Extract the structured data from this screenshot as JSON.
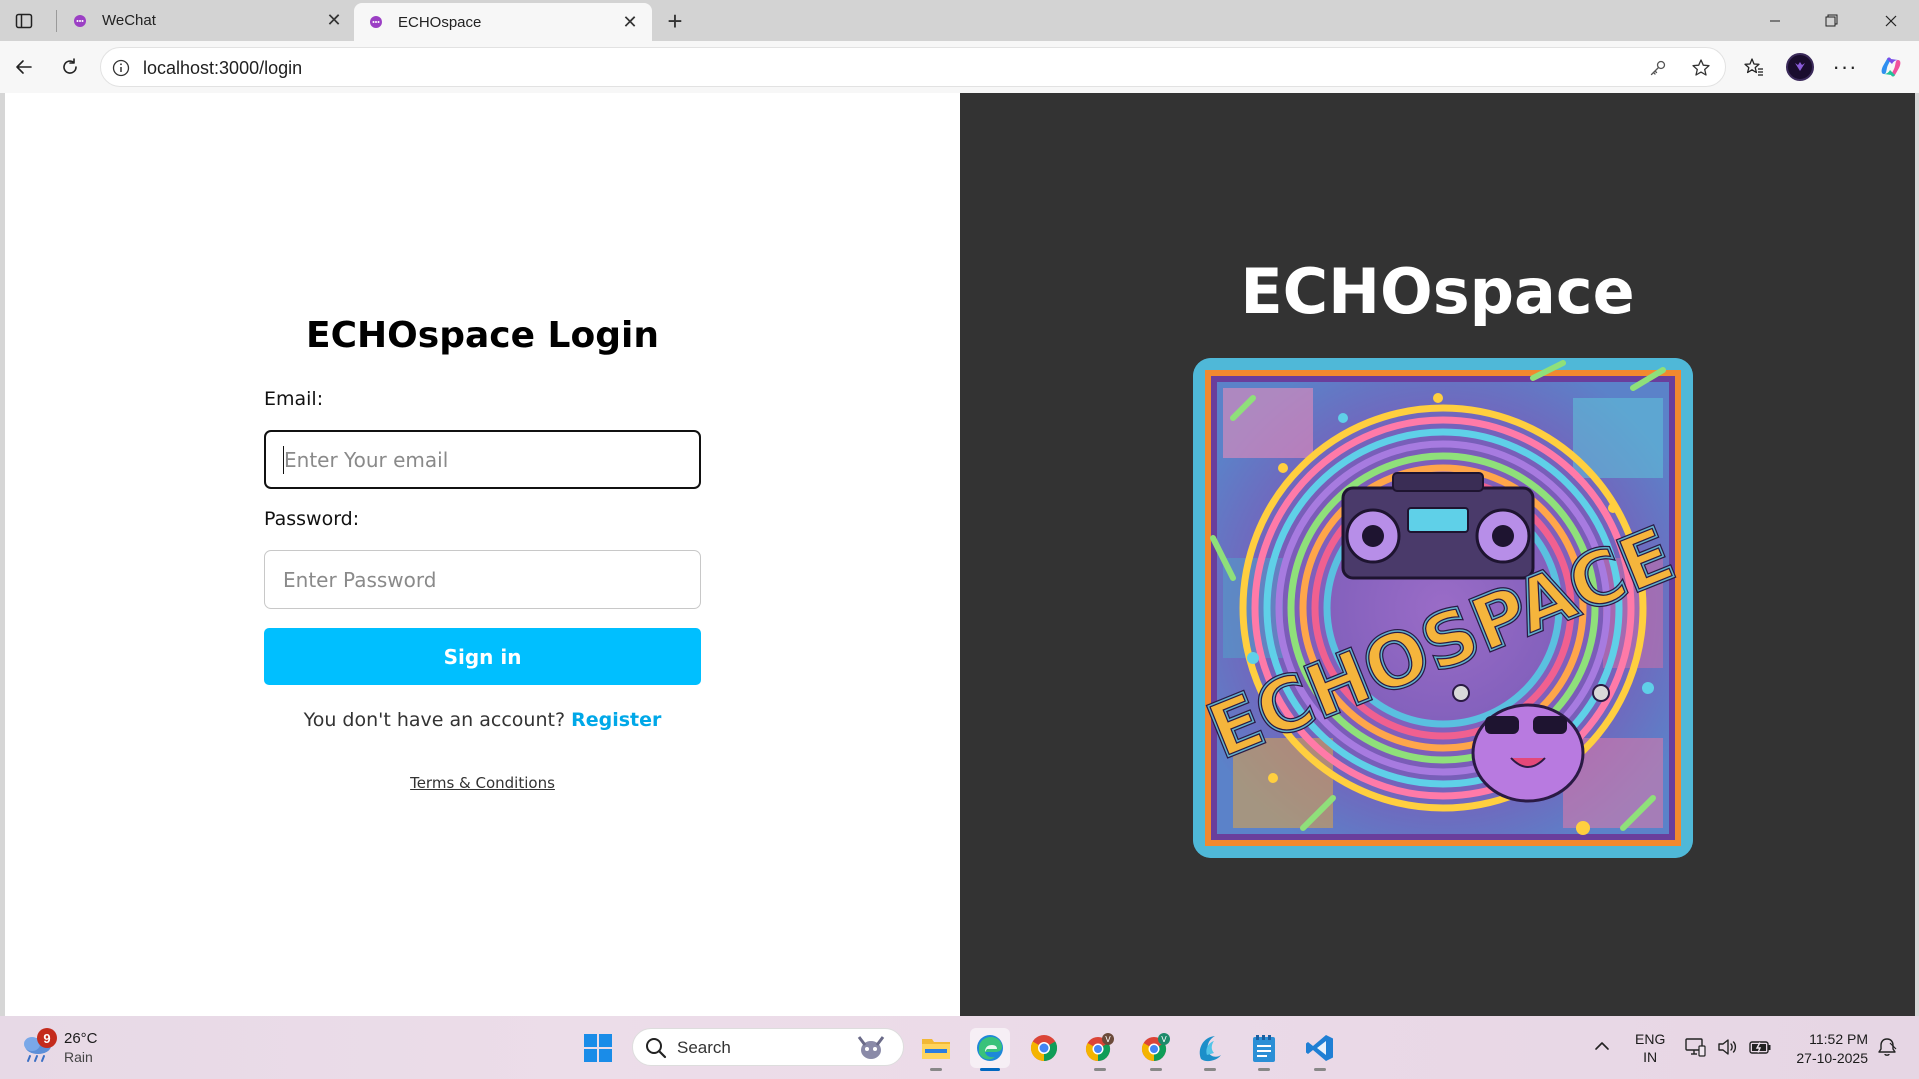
{
  "browser": {
    "tabs": [
      {
        "title": "WeChat",
        "active": false
      },
      {
        "title": "ECHOspace",
        "active": true
      }
    ],
    "url": "localhost:3000/login",
    "accent": "#0067c0"
  },
  "login": {
    "title": "ECHOspace Login",
    "email_label": "Email:",
    "email_placeholder": "Enter Your email",
    "password_label": "Password:",
    "password_placeholder": "Enter Password",
    "signin_label": "Sign in",
    "register_prompt": "You don't have an account?",
    "register_link": "Register",
    "terms_link": "Terms & Conditions",
    "button_color": "#00bfff"
  },
  "brand": {
    "title": "ECHOspace",
    "artwork_icon": "echospace-artwork-image",
    "panel_color": "#333333"
  },
  "taskbar": {
    "weather": {
      "badge": "9",
      "temp": "26°C",
      "condition": "Rain"
    },
    "search_label": "Search",
    "apps": [
      {
        "name": "file-explorer-icon"
      },
      {
        "name": "edge-icon",
        "active": true
      },
      {
        "name": "chrome-icon"
      },
      {
        "name": "chrome-profile-v-icon"
      },
      {
        "name": "chrome-profile-v2-icon"
      },
      {
        "name": "app-wave-icon"
      },
      {
        "name": "notepad-icon"
      },
      {
        "name": "vscode-icon"
      }
    ],
    "language": {
      "line1": "ENG",
      "line2": "IN"
    },
    "clock": {
      "time": "11:52 PM",
      "date": "27-10-2025"
    }
  }
}
